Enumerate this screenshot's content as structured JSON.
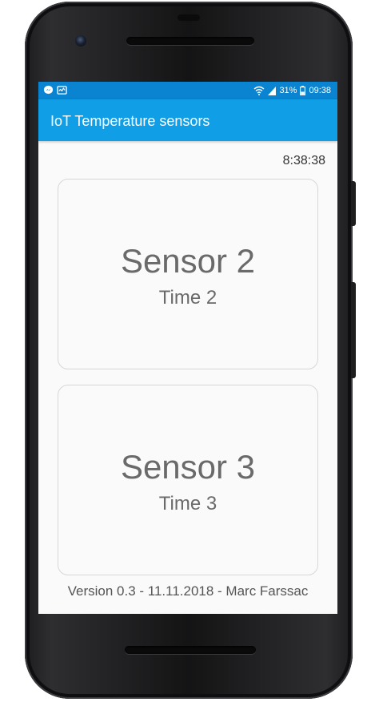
{
  "status_bar": {
    "battery": "31%",
    "time": "09:38",
    "icons": [
      "messenger-icon",
      "activity-icon",
      "wifi-icon",
      "signal-icon",
      "battery-icon"
    ]
  },
  "app_bar": {
    "title": "IoT Temperature sensors"
  },
  "clock": "8:38:38",
  "cards": [
    {
      "title": "Sensor 2",
      "subtitle": "Time 2"
    },
    {
      "title": "Sensor 3",
      "subtitle": "Time 3"
    }
  ],
  "footer": "Version 0.3 - 11.11.2018 - Marc Farssac",
  "colors": {
    "status_bar": "#0a84d0",
    "app_bar": "#109ee6",
    "text": "#6a6a6a"
  }
}
